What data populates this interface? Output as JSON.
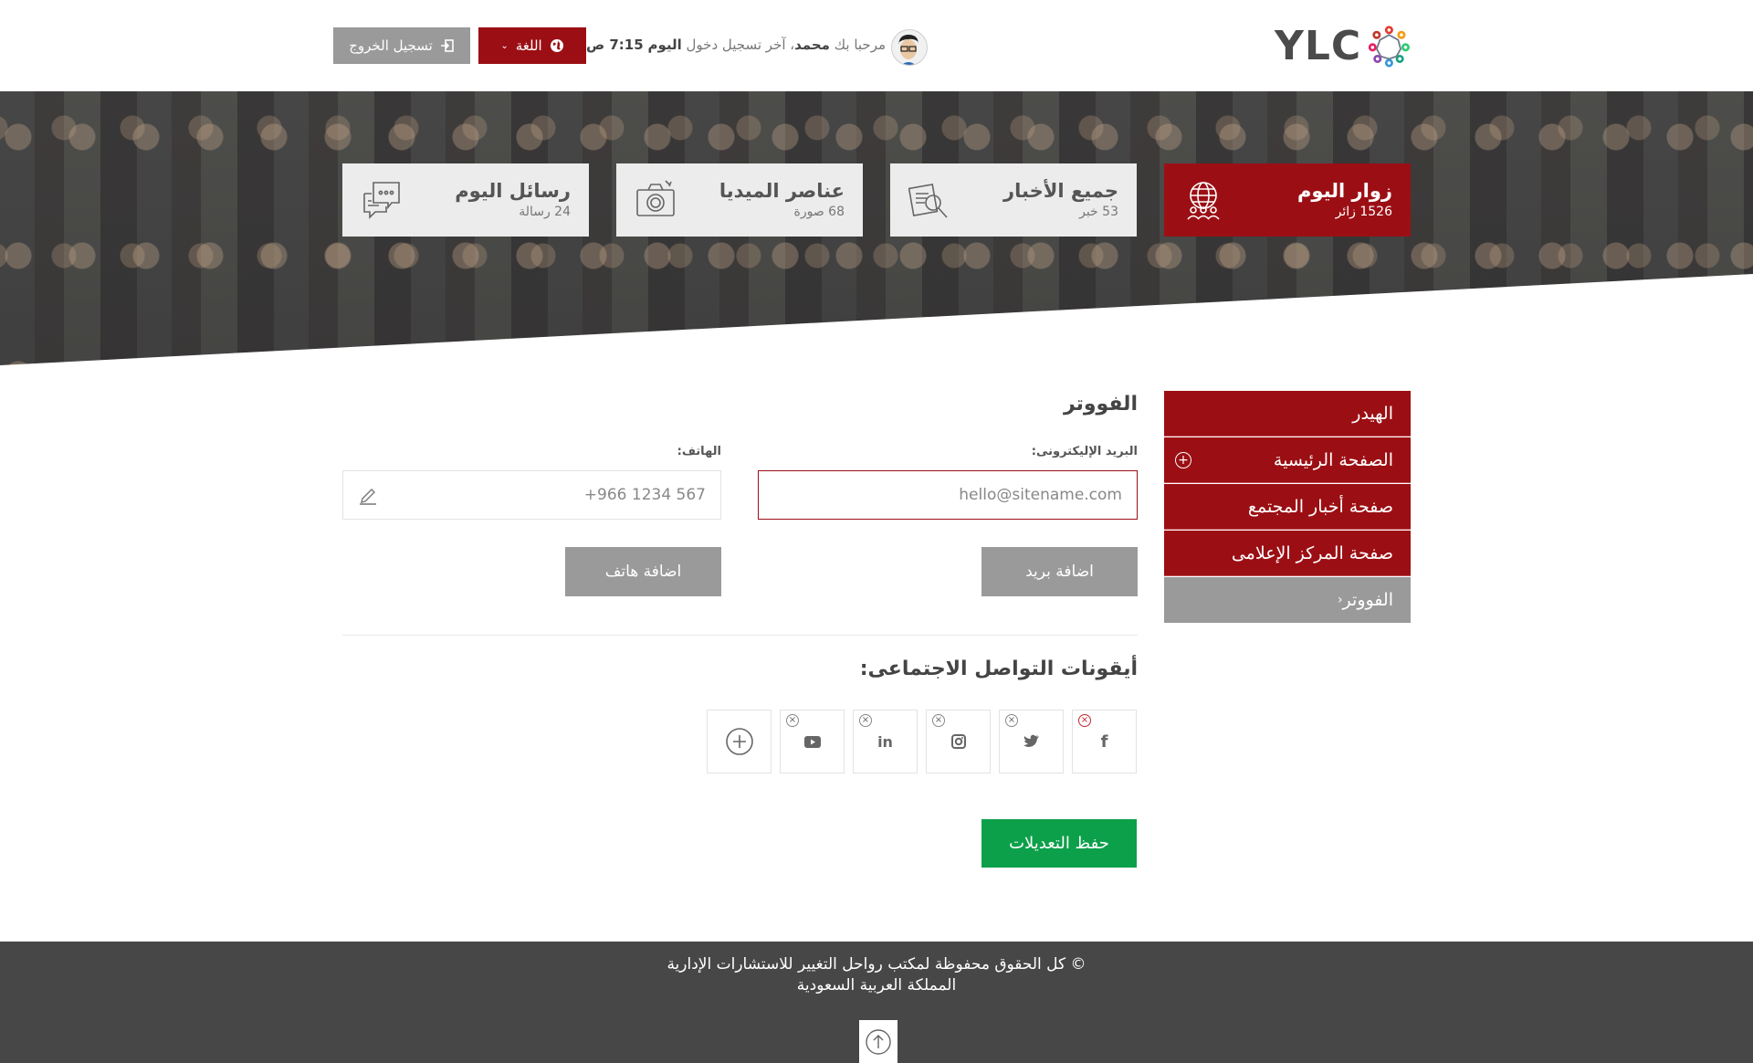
{
  "header": {
    "logo_text": "YLC",
    "welcome_prefix": "مرحبا بك",
    "user_name": "محمد",
    "last_login_label": "، آخر تسجيل دخول",
    "last_login_day": "اليوم",
    "last_login_time": "7:15 ص",
    "language_button": "اللغة",
    "logout_button": "تسجيل الخروج"
  },
  "stats": [
    {
      "title": "زوار اليوم",
      "subtitle": "1526 زائر",
      "icon": "globe-people-icon",
      "active": true
    },
    {
      "title": "جميع الأخبار",
      "subtitle": "53 خبر",
      "icon": "news-search-icon",
      "active": false
    },
    {
      "title": "عناصر الميديا",
      "subtitle": "68 صورة",
      "icon": "camera-icon",
      "active": false
    },
    {
      "title": "رسائل اليوم",
      "subtitle": "24 رسالة",
      "icon": "chat-bubbles-icon",
      "active": false
    }
  ],
  "sidebar": {
    "items": [
      {
        "label": "الهيدر"
      },
      {
        "label": "الصفحة الرئيسية",
        "has_plus": true
      },
      {
        "label": "صفحة أخبار المجتمع"
      },
      {
        "label": "صفحة المركز الإعلامى"
      },
      {
        "label": "الفووتر",
        "active": true
      }
    ]
  },
  "form": {
    "section_title": "الفووتر",
    "email_label": "البريد الإليكترونى:",
    "email_value": "hello@sitename.com",
    "phone_label": "الهاتف:",
    "phone_value": "+966 1234 567",
    "add_email_button": "اضافة بريد",
    "add_phone_button": "اضافة هاتف",
    "social_title": "أيقونات التواصل الاجتماعى:",
    "social_icons": [
      "facebook-icon",
      "twitter-icon",
      "instagram-icon",
      "linkedin-icon",
      "youtube-icon"
    ],
    "save_button": "حفظ التعديلات"
  },
  "footer": {
    "copyright": "© كل الحقوق محفوظة لمكتب رواحل التغيير للاستشارات الإدارية",
    "country": "المملكة العربية السعودية"
  },
  "colors": {
    "brand_red": "#9b0f14",
    "gray_button": "#9a9a9a",
    "save_green": "#0da04a",
    "footer_bg": "#474747"
  }
}
